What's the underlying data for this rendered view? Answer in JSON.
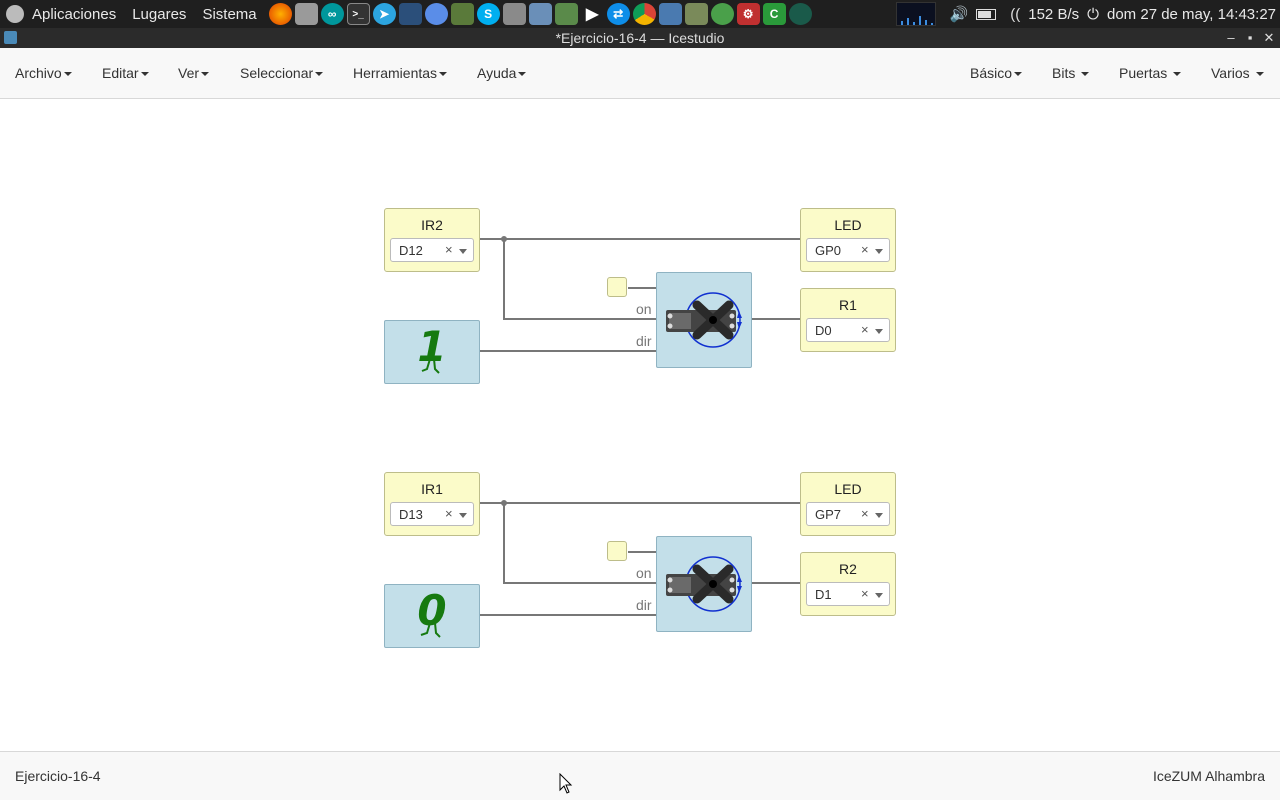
{
  "system_panel": {
    "menus": [
      "Aplicaciones",
      "Lugares",
      "Sistema"
    ],
    "launchers": [
      "firefox-icon",
      "files-icon",
      "arduino-icon",
      "terminal-icon",
      "telegram-icon",
      "monitor-icon",
      "chromium-icon",
      "tools-icon",
      "skype-icon",
      "calculator-icon",
      "virtualbox-icon",
      "spreadsheet-icon",
      "play-icon",
      "teamviewer-icon",
      "chrome-icon",
      "maps-icon",
      "settings-icon",
      "clover-icon",
      "gear-icon",
      "c-icon",
      "gitkraken-icon"
    ],
    "network_speed": "152 B/s",
    "datetime": "dom 27 de may, 14:43:27"
  },
  "window": {
    "title": "*Ejercicio-16-4 — Icestudio"
  },
  "menubar": {
    "left": [
      "Archivo",
      "Editar",
      "Ver",
      "Seleccionar",
      "Herramientas",
      "Ayuda"
    ],
    "right": [
      "Básico",
      "Bits",
      "Puertas",
      "Varios"
    ]
  },
  "circuit1": {
    "input": {
      "label": "IR2",
      "pin": "D12"
    },
    "const": "1",
    "led": {
      "label": "LED",
      "pin": "GP0"
    },
    "servo_out": {
      "label": "R1",
      "pin": "D0"
    },
    "ports": {
      "on": "on",
      "dir": "dir"
    }
  },
  "circuit2": {
    "input": {
      "label": "IR1",
      "pin": "D13"
    },
    "const": "0",
    "led": {
      "label": "LED",
      "pin": "GP7"
    },
    "servo_out": {
      "label": "R2",
      "pin": "D1"
    },
    "ports": {
      "on": "on",
      "dir": "dir"
    }
  },
  "statusbar": {
    "project": "Ejercicio-16-4",
    "board": "IceZUM Alhambra"
  }
}
